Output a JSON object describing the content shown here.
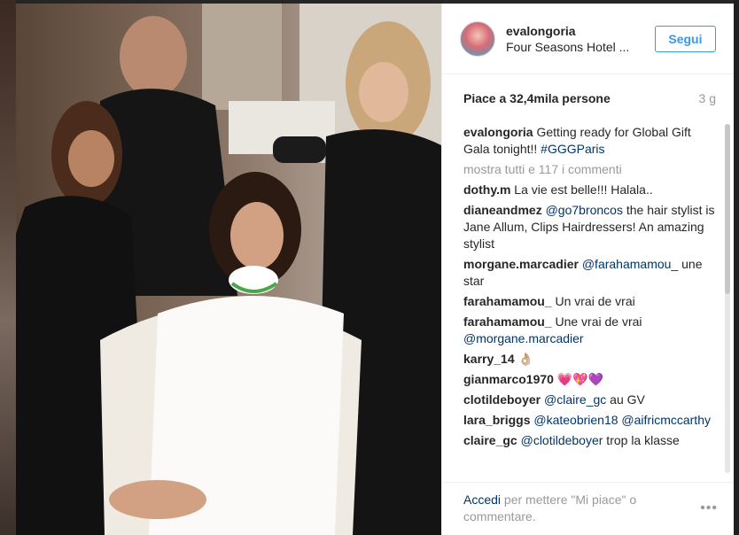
{
  "post": {
    "username": "evalongoria",
    "location": "Four Seasons Hotel ...",
    "follow_label": "Segui",
    "likes": "Piace a 32,4mila persone",
    "time": "3 g"
  },
  "caption": {
    "user": "evalongoria",
    "text": "Getting ready for Global Gift Gala tonight!! ",
    "hashtag": "#GGGParis"
  },
  "view_all": "mostra tutti e 117 i commenti",
  "comments": [
    {
      "user": "dothy.m",
      "pre": "La vie est belle!!! Halala..",
      "mention": "",
      "post": ""
    },
    {
      "user": "dianeandmez",
      "pre": "",
      "mention": "@go7broncos",
      "post": " the hair stylist is Jane Allum, Clips Hairdressers! An amazing stylist"
    },
    {
      "user": "morgane.marcadier",
      "pre": "",
      "mention": "@farahamamou_",
      "post": " une star"
    },
    {
      "user": "farahamamou_",
      "pre": "Un vrai de vrai",
      "mention": "",
      "post": ""
    },
    {
      "user": "farahamamou_",
      "pre": "Une vrai de vrai ",
      "mention": "@morgane.marcadier",
      "post": ""
    },
    {
      "user": "karry_14",
      "pre": "👌🏼",
      "mention": "",
      "post": ""
    },
    {
      "user": "gianmarco1970",
      "pre": "💗💖💜",
      "mention": "",
      "post": ""
    },
    {
      "user": "clotildeboyer",
      "pre": "",
      "mention": "@claire_gc",
      "post": " au GV"
    },
    {
      "user": "lara_briggs",
      "pre": "",
      "mention": "@kateobrien18 @aifricmccarthy",
      "post": ""
    },
    {
      "user": "claire_gc",
      "pre": "",
      "mention": "@clotildeboyer",
      "post": " trop la klasse"
    }
  ],
  "footer": {
    "login_link": "Accedi",
    "login_rest": " per mettere \"Mi piace\" o commentare.",
    "more_icon": "•••"
  },
  "colors": {
    "link_blue": "#3897f0",
    "mention_blue": "#003569",
    "muted": "#999999"
  }
}
